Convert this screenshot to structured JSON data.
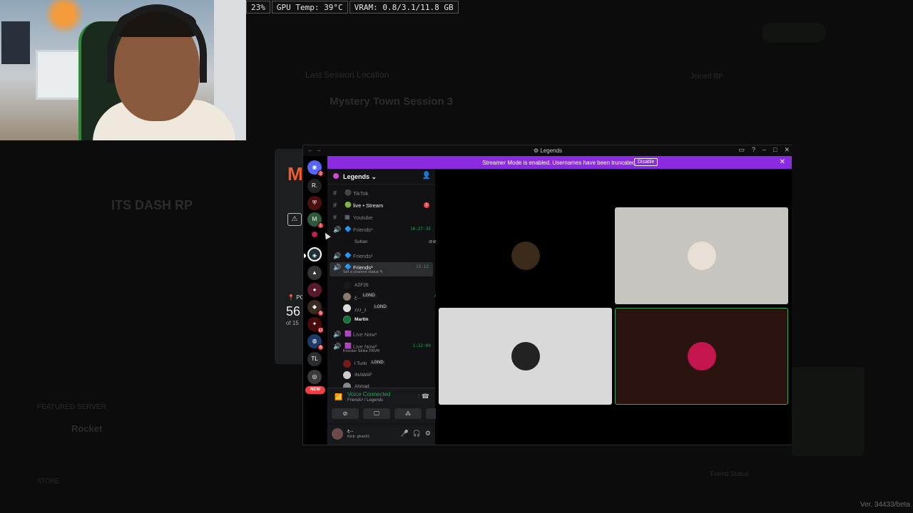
{
  "stats_bar": {
    "cpu": "23%",
    "gpu_temp": "GPU Temp: 39°C",
    "vram": "VRAM: 0.8/3.1/11.8 GB"
  },
  "launcher": {
    "pc_label": "PC",
    "count": "56",
    "of_label": "of 15"
  },
  "background_app": {
    "section_title": "Last Session Location",
    "session": "Mystery Town Session 3",
    "side_title": "Joined RP",
    "player": "ITS DASH RP",
    "featured_label": "FEATURED SERVER",
    "featured_name": "Rocket",
    "store_label": "STORE",
    "right_stat": "Friend Status"
  },
  "discord": {
    "window_title": "Legends",
    "banner": {
      "message": "Streamer Mode is enabled. Usernames have been truncated.",
      "button": "Disable"
    },
    "server_name": "Legends",
    "new_tag": "NEW",
    "server_badges": [
      "2",
      "1",
      "1",
      "5",
      "17",
      "6"
    ],
    "channels": [
      {
        "type": "text",
        "emoji": "⚫",
        "name": "TikTok"
      },
      {
        "type": "text",
        "emoji": "🟢",
        "name": "live • Stream",
        "unread": "1"
      },
      {
        "type": "text",
        "emoji": "▦",
        "name": "Youtube"
      },
      {
        "type": "voice",
        "emoji": "🔷",
        "name": "Friends¹",
        "time": "16:27:35"
      },
      {
        "type": "voice",
        "emoji": "🔷",
        "name": "Friends²"
      },
      {
        "type": "voice",
        "emoji": "🔷",
        "name": "Friends³",
        "time": "13:12",
        "status": "Set a channel status ✎"
      },
      {
        "type": "voice",
        "emoji": "🟪",
        "name": "Live Now¹"
      },
      {
        "type": "voice",
        "emoji": "🟪",
        "name": "Live Now²",
        "time": "1:22:09",
        "status": "Krunker Strike FRVR"
      }
    ],
    "friends1_members": [
      {
        "name": "Sultan"
      }
    ],
    "friends3_members": [
      {
        "name": "AZF25"
      },
      {
        "name": "ع...",
        "tag": "LGND"
      },
      {
        "name": "ﾒﾒﾒ_ﾒ",
        "tag": "LGND"
      },
      {
        "name": "Martin"
      }
    ],
    "livenow2_members": [
      {
        "name": "l Turki",
        "tag": "LGND"
      },
      {
        "name": "INAWAF"
      },
      {
        "name": "Ahmad"
      }
    ],
    "voice_panel": {
      "status": "Voice Connected",
      "location": "Friends³ / Legends"
    },
    "user_panel": {
      "name": "ع...",
      "status": "Kick: ghaz91"
    },
    "tiles": [
      {
        "bg": "#000000",
        "avatar": "#3a2a1a"
      },
      {
        "bg": "#c8c4bf",
        "avatar": "#e8e0d6"
      },
      {
        "bg": "#d9d9d9",
        "avatar": "#222222"
      },
      {
        "bg": "#2b1410",
        "avatar": "#c4154e"
      }
    ]
  },
  "version": "Ver. 34433/beta"
}
